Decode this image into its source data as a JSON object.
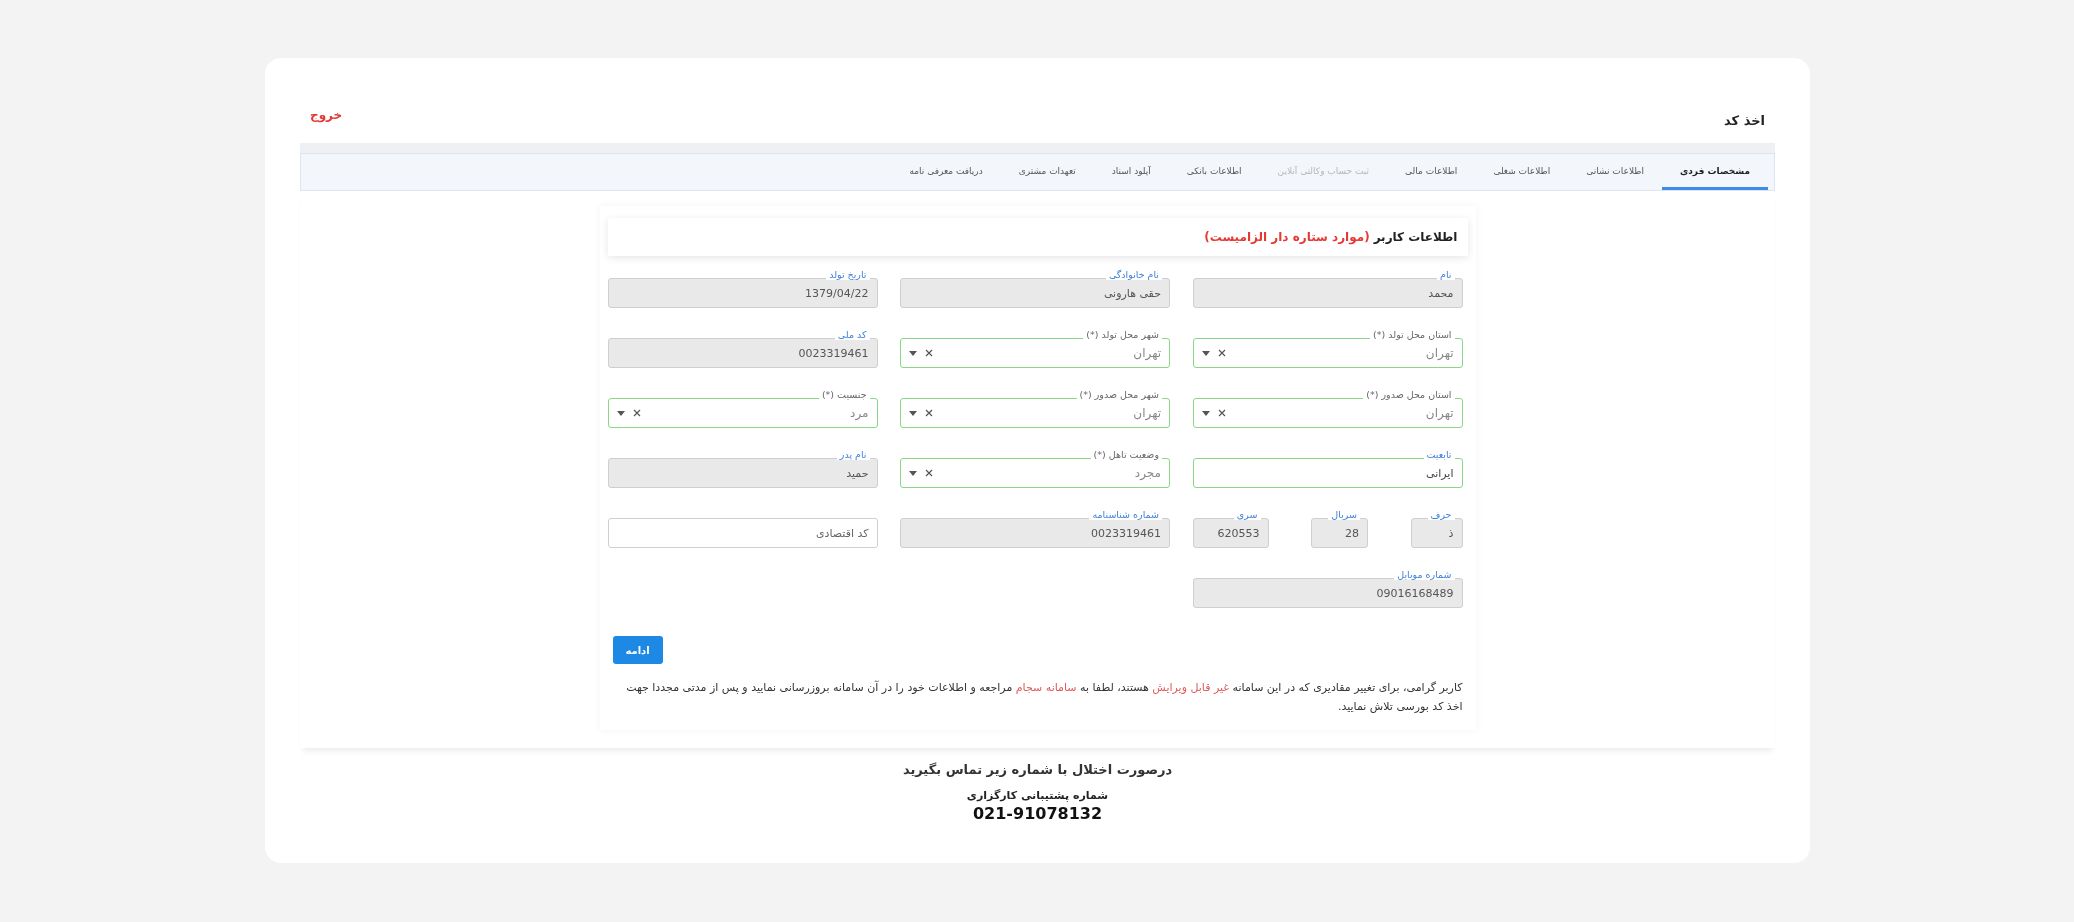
{
  "header": {
    "title": "اخذ کد",
    "logout": "خروج"
  },
  "tabs": [
    {
      "label": "مشخصات فردی",
      "selected": true,
      "disabled": false
    },
    {
      "label": "اطلاعات نشانی",
      "selected": false,
      "disabled": false
    },
    {
      "label": "اطلاعات شغلی",
      "selected": false,
      "disabled": false
    },
    {
      "label": "اطلاعات مالی",
      "selected": false,
      "disabled": false
    },
    {
      "label": "ثبت حساب وکالتی آنلاین",
      "selected": false,
      "disabled": true
    },
    {
      "label": "اطلاعات بانکی",
      "selected": false,
      "disabled": false
    },
    {
      "label": "آپلود اسناد",
      "selected": false,
      "disabled": false
    },
    {
      "label": "تعهدات مشتری",
      "selected": false,
      "disabled": false
    },
    {
      "label": "دریافت معرفی نامه",
      "selected": false,
      "disabled": false
    }
  ],
  "form": {
    "title": "اطلاعات کاربر",
    "required_note": "(موارد ستاره دار الزامیست)",
    "rows": [
      [
        {
          "kind": "text",
          "label": "نام",
          "value": "محمد",
          "disabled": true,
          "valid": false
        },
        {
          "kind": "text",
          "label": "نام خانوادگی",
          "value": "حقی هارونی",
          "disabled": true,
          "valid": false
        },
        {
          "kind": "text",
          "label": "تاریخ تولد",
          "value": "1379/04/22",
          "disabled": true,
          "valid": false
        }
      ],
      [
        {
          "kind": "select",
          "label": "استان محل تولد (*)",
          "value": "تهران",
          "disabled": false,
          "valid": true
        },
        {
          "kind": "select",
          "label": "شهر محل تولد (*)",
          "value": "تهران",
          "disabled": false,
          "valid": true
        },
        {
          "kind": "text",
          "label": "کد ملی",
          "value": "0023319461",
          "disabled": true,
          "valid": false
        }
      ],
      [
        {
          "kind": "select",
          "label": "استان محل صدور (*)",
          "value": "تهران",
          "disabled": false,
          "valid": true
        },
        {
          "kind": "select",
          "label": "شهر محل صدور (*)",
          "value": "تهران",
          "disabled": false,
          "valid": true
        },
        {
          "kind": "select",
          "label": "جنسیت (*)",
          "value": "مرد",
          "disabled": false,
          "valid": true
        }
      ],
      [
        {
          "kind": "text",
          "label": "تابعیت",
          "value": "ایرانی",
          "disabled": false,
          "valid": true
        },
        {
          "kind": "select",
          "label": "وضعیت تاهل (*)",
          "value": "مجرد",
          "disabled": false,
          "valid": true
        },
        {
          "kind": "text",
          "label": "نام پدر",
          "value": "حمید",
          "disabled": true,
          "valid": false
        }
      ],
      [
        {
          "kind": "group",
          "fields": [
            {
              "kind": "text",
              "label": "حرف",
              "value": "ذ",
              "disabled": true,
              "valid": false
            },
            {
              "kind": "text",
              "label": "سریال",
              "value": "28",
              "disabled": true,
              "valid": false
            },
            {
              "kind": "text",
              "label": "سری",
              "value": "620553",
              "disabled": true,
              "valid": false
            }
          ]
        },
        {
          "kind": "text",
          "label": "شماره شناسنامه",
          "value": "0023319461",
          "disabled": true,
          "valid": false
        },
        {
          "kind": "text",
          "placeholder": "کد اقتصادی",
          "disabled": false,
          "valid": false
        }
      ],
      [
        {
          "kind": "text",
          "label": "شماره موبایل",
          "value": "09016168489",
          "disabled": true,
          "valid": false
        }
      ]
    ],
    "submit": "ادامه",
    "note": [
      {
        "kind": "plain",
        "text": "کاربر گرامی، برای تغییر مقادیری که در این سامانه "
      },
      {
        "kind": "link",
        "text": "غیر قابل ویرایش"
      },
      {
        "kind": "plain",
        "text": " هستند، لطفا به "
      },
      {
        "kind": "link",
        "text": "سامانه سجام"
      },
      {
        "kind": "plain",
        "text": " مراجعه و اطلاعات خود را در آن سامانه بروزرسانی نمایید و پس از مدتی مجددا جهت اخذ کد بورسی تلاش نمایید."
      }
    ]
  },
  "footer": {
    "message": "درصورت اختلال با شماره زیر تماس بگیرید",
    "support_label": "شماره پشتیبانی کارگزاری",
    "phone": "021-91078132"
  }
}
